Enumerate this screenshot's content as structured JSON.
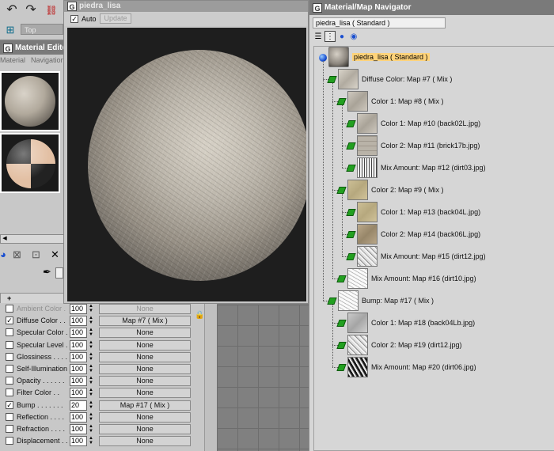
{
  "preview": {
    "title": "piedra_lisa",
    "auto_label": "Auto",
    "auto_checked": true,
    "update_label": "Update"
  },
  "background": {
    "viewport_label": "Top"
  },
  "material_editor": {
    "title": "Material Editor",
    "menu": [
      "Material",
      "Navigation"
    ],
    "rollout_marks": [
      "+",
      "+",
      "-"
    ]
  },
  "maps": [
    {
      "label": "Ambient Color . .",
      "checked": false,
      "amount": "100",
      "map": "None",
      "dim": true
    },
    {
      "label": "Diffuse Color . .",
      "checked": true,
      "amount": "100",
      "map": "Map #7  ( Mix )",
      "dim": false
    },
    {
      "label": "Specular Color . .",
      "checked": false,
      "amount": "100",
      "map": "None",
      "dim": false
    },
    {
      "label": "Specular Level . .",
      "checked": false,
      "amount": "100",
      "map": "None",
      "dim": false
    },
    {
      "label": "Glossiness . . . .",
      "checked": false,
      "amount": "100",
      "map": "None",
      "dim": false
    },
    {
      "label": "Self-Illumination .",
      "checked": false,
      "amount": "100",
      "map": "None",
      "dim": false
    },
    {
      "label": "Opacity . . . . . .",
      "checked": false,
      "amount": "100",
      "map": "None",
      "dim": false
    },
    {
      "label": "Filter Color . .",
      "checked": false,
      "amount": "100",
      "map": "None",
      "dim": false
    },
    {
      "label": "Bump . . . . . . .",
      "checked": true,
      "amount": "20",
      "map": "Map #17  ( Mix )",
      "dim": false
    },
    {
      "label": "Reflection . . . .",
      "checked": false,
      "amount": "100",
      "map": "None",
      "dim": false
    },
    {
      "label": "Refraction . . . .",
      "checked": false,
      "amount": "100",
      "map": "None",
      "dim": false
    },
    {
      "label": "Displacement . .",
      "checked": false,
      "amount": "100",
      "map": "None",
      "dim": false
    }
  ],
  "navigator": {
    "title": "Material/Map Navigator",
    "field": "piedra_lisa  ( Standard )",
    "nodes": [
      {
        "label": "piedra_lisa  ( Standard )",
        "thumb": "t-root",
        "root": true
      },
      {
        "label": "Diffuse Color: Map #7  ( Mix )",
        "thumb": "t-mix"
      },
      {
        "label": "Color 1: Map #8  ( Mix )",
        "thumb": "t-stone"
      },
      {
        "label": "Color 1: Map #10 (back02L.jpg)",
        "thumb": "t-stone"
      },
      {
        "label": "Color 2: Map #11  (brick17b.jpg)",
        "thumb": "t-brick"
      },
      {
        "label": "Mix Amount: Map #12 (dirt03.jpg)",
        "thumb": "t-dirt"
      },
      {
        "label": "Color 2: Map #9  ( Mix )",
        "thumb": "t-sand"
      },
      {
        "label": "Color 1: Map #13 (back04L.jpg)",
        "thumb": "t-sand"
      },
      {
        "label": "Color 2: Map #14 (back06L.jpg)",
        "thumb": "t-brown"
      },
      {
        "label": "Mix Amount: Map #15 (dirt12.jpg)",
        "thumb": "t-noise"
      },
      {
        "label": "Mix Amount: Map #16 (dirt10.jpg)",
        "thumb": "t-white"
      },
      {
        "label": "Bump: Map #17  ( Mix )",
        "thumb": "t-white"
      },
      {
        "label": "Color 1: Map #18 (back04Lb.jpg)",
        "thumb": "t-gray"
      },
      {
        "label": "Color 2: Map #19 (dirt12.jpg)",
        "thumb": "t-noise"
      },
      {
        "label": "Mix Amount: Map #20 (dirt06.jpg)",
        "thumb": "t-dark"
      }
    ]
  },
  "colors": {
    "title_bar": "#7a7a7a",
    "panel": "#c8c8c8",
    "highlight": "#ffd37a",
    "node_icon": "#22a020"
  },
  "icons": [
    "undo-icon",
    "redo-icon",
    "link-icon",
    "lock-icon",
    "eyedropper-icon",
    "close-icon",
    "list-view-icon",
    "tree-view-icon",
    "sphere-small-icon",
    "sphere-large-icon"
  ]
}
